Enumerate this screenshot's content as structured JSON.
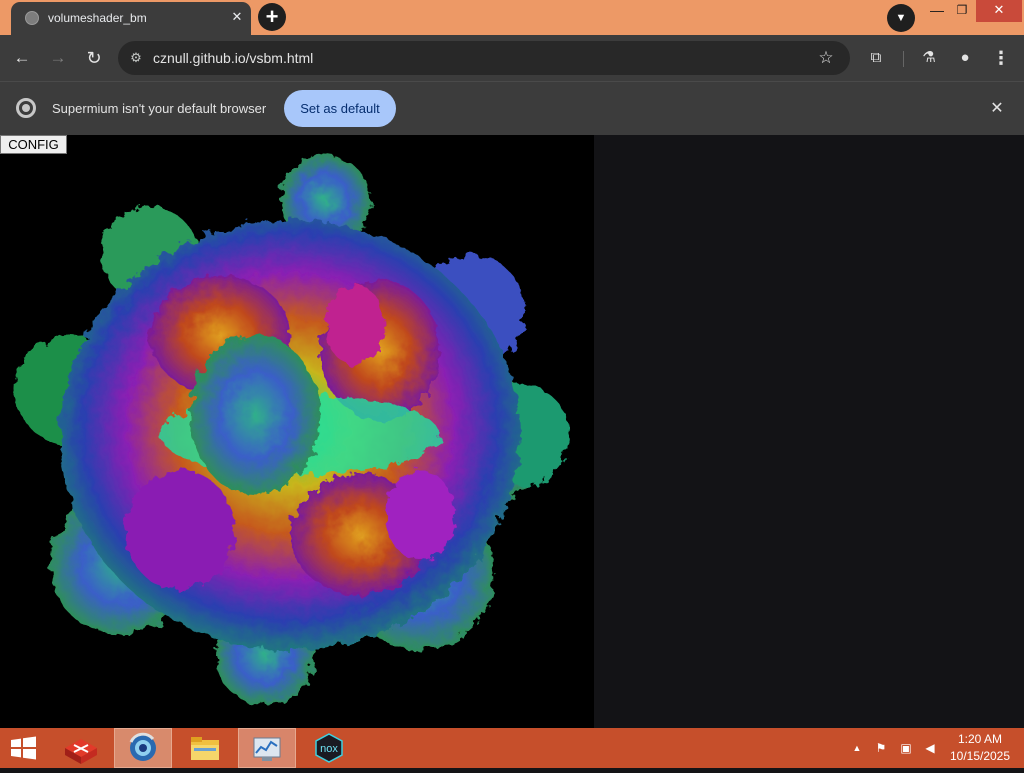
{
  "window": {
    "minimize_glyph": "—",
    "restore_glyph": "❐",
    "close_glyph": "✕"
  },
  "tab": {
    "title": "volumeshader_bm",
    "close_glyph": "✕"
  },
  "toolbar": {
    "back_glyph": "←",
    "forward_glyph": "→",
    "reload_glyph": "↻",
    "url": "cznull.github.io/vsbm.html",
    "star_glyph": "☆",
    "extensions_glyph": "⧉",
    "labs_glyph": "⚗",
    "profile_glyph": "●",
    "menu_glyph": "⋮",
    "newtab_glyph": "+",
    "tabsearch_glyph": "▼",
    "site_info_glyph": "⚙"
  },
  "infobar": {
    "message": "Supermium isn't your default browser",
    "button_label": "Set as default",
    "close_glyph": "✕"
  },
  "page": {
    "config_label": "CONFIG"
  },
  "taskbar": {
    "clock_time": "1:20 AM",
    "clock_date": "10/15/2025",
    "tray_up_glyph": "▲",
    "tray_flag_glyph": "⚑",
    "tray_network_glyph": "▣",
    "tray_volume_glyph": "◀",
    "app5_label": "nox"
  },
  "colors": {
    "titlebar": "#ed9966",
    "toolbar": "#3c3c3c",
    "accent_button": "#a8c7fa",
    "taskbar": "#c64f2b",
    "canvas": "#000000"
  }
}
